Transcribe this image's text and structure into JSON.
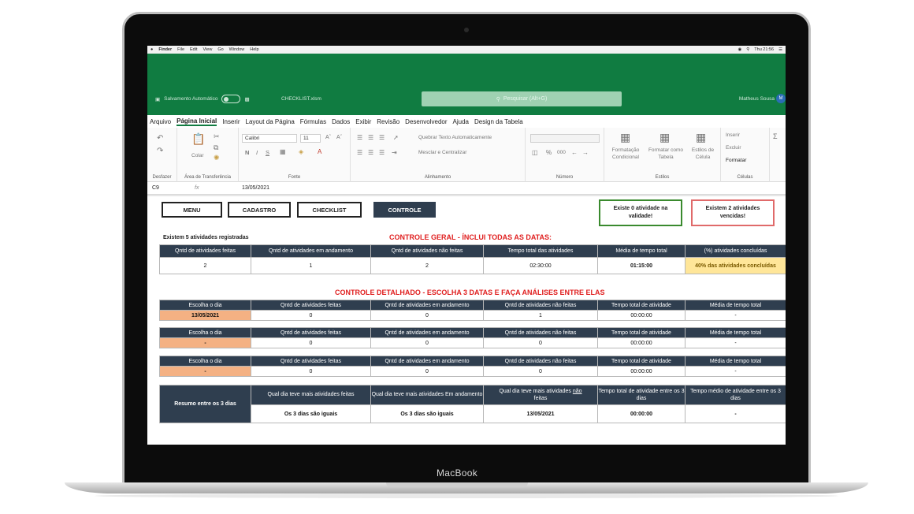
{
  "device": {
    "label": "MacBook"
  },
  "macbar": {
    "items": [
      "Finder",
      "File",
      "Edit",
      "View",
      "Go",
      "Window",
      "Help"
    ],
    "clock": "Thu 21:56"
  },
  "excel": {
    "autosave_label": "Salvamento Automático",
    "filename": "CHECKLIST.xlsm",
    "search_placeholder": "Pesquisar (Alt+G)",
    "user_name": "Matheus Sousa",
    "user_initial": "M",
    "tabs": [
      "Arquivo",
      "Página Inicial",
      "Inserir",
      "Layout da Página",
      "Fórmulas",
      "Dados",
      "Exibir",
      "Revisão",
      "Desenvolvedor",
      "Ajuda",
      "Design da Tabela"
    ],
    "ribbon": {
      "undo_group": "Desfazer",
      "clipboard_group": "Área de Transferência",
      "paste_label": "Colar",
      "font_group": "Fonte",
      "font_name": "Calibri",
      "font_size": "11",
      "bold_glyph": "N",
      "italic_glyph": "I",
      "underline_glyph": "S",
      "alignment_group": "Alinhamento",
      "wrap_text": "Quebrar Texto Automaticamente",
      "merge_center": "Mesclar e Centralizar",
      "number_group": "Número",
      "styles_group": "Estilos",
      "cond_format": "Formatação Condicional",
      "format_table": "Formatar como Tabela",
      "cell_styles": "Estilos de Célula",
      "cells_group": "Células",
      "insert": "Inserir",
      "delete": "Excluir",
      "format": "Formatar"
    },
    "formula_bar": {
      "cell_ref": "C9",
      "fx": "fx",
      "value": "13/05/2021"
    }
  },
  "sheet": {
    "nav": [
      "MENU",
      "CADASTRO",
      "CHECKLIST",
      "CONTROLE"
    ],
    "alert_valid": "Existe 0 atividade na validade!",
    "alert_overdue": "Existem 2 atividades vencidas!",
    "registered": "Existem 5 atividades registradas",
    "general_title": "CONTROLE GERAL - ÍNCLUI TODAS AS DATAS:",
    "general_headers": [
      "Qntd de atividades feitas",
      "Qntd de atividades em andamento",
      "Qntd de atividades não feitas",
      "Tempo total das atividades",
      "Média de tempo total",
      "(%) atividades concluídas"
    ],
    "general_values": [
      "2",
      "1",
      "2",
      "02:30:00",
      "01:15:00",
      "40% das atividades concluídas"
    ],
    "detail_title": "CONTROLE DETALHADO - ESCOLHA 3 DATAS E FAÇA ANÁLISES ENTRE ELAS",
    "detail_headers": [
      "Escolha o dia",
      "Qntd de atividades feitas",
      "Qntd de atividades em andamento",
      "Qntd de atividades não feitas",
      "Tempo total de atividade",
      "Média de tempo total"
    ],
    "detail_rows": [
      [
        "13/05/2021",
        "0",
        "0",
        "1",
        "00:00:00",
        "-"
      ],
      [
        "-",
        "0",
        "0",
        "0",
        "00:00:00",
        "-"
      ],
      [
        "-",
        "0",
        "0",
        "0",
        "00:00:00",
        "-"
      ]
    ],
    "summary_label": "Resumo entre os 3 dias",
    "summary_headers": [
      "Qual dia teve mais atividades feitas",
      "Qual dia teve mais atividades Em andamento",
      "Qual dia teve mais atividades",
      "não",
      "feitas",
      "Tempo total de atividade entre os 3 dias",
      "Tempo médio de atividade entre os 3 dias"
    ],
    "summary_values": [
      "Os 3 dias são iguais",
      "Os 3 dias são iguais",
      "13/05/2021",
      "00:00:00",
      "-"
    ]
  }
}
